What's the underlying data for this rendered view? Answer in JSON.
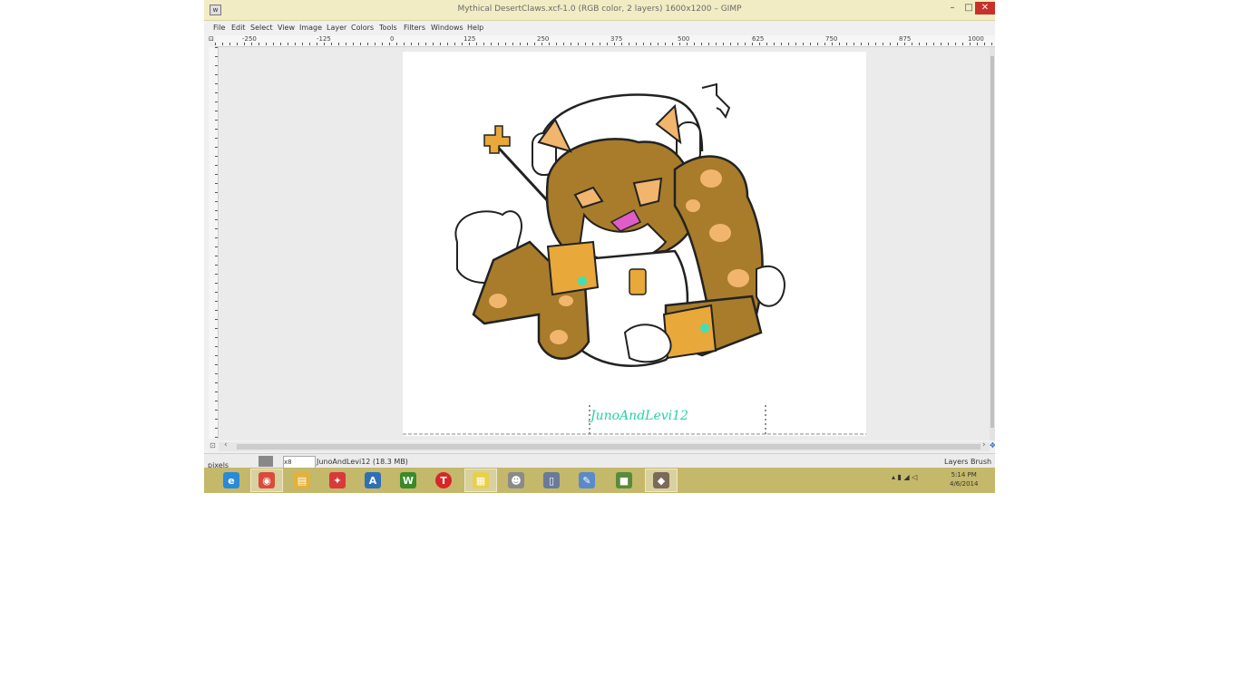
{
  "window": {
    "title": "Mythical DesertClaws.xcf-1.0 (RGB color, 2 layers) 1600x1200 – GIMP",
    "app_icon": "wilber-icon",
    "minimize_label": "–",
    "maximize_label": "□",
    "close_label": "✕"
  },
  "menu": [
    "File",
    "Edit",
    "Select",
    "View",
    "Image",
    "Layer",
    "Colors",
    "Tools",
    "Filters",
    "Windows",
    "Help"
  ],
  "ruler": {
    "corner": "⊡",
    "h_labels": [
      "-250",
      "-125",
      "0",
      "125",
      "250",
      "375",
      "500",
      "625",
      "750",
      "875",
      "1000"
    ]
  },
  "canvas": {
    "signature": "JunoAndLevi12",
    "colors": {
      "fur": "#a87c2a",
      "spots": "#f2b56e",
      "tongue": "#e05cc8",
      "cuff": "#e8a83a",
      "gem": "#3fe0b8",
      "signature": "#22d3a4"
    }
  },
  "statusbar": {
    "unit": "pixels",
    "zoom": "x8",
    "file": "JunoAndLevi12 (18.3 MB)",
    "dock_tabs": "Layers  Brush"
  },
  "taskbar": {
    "apps": [
      {
        "name": "ie-icon",
        "glyph": "e",
        "color": "#2a8ad8"
      },
      {
        "name": "chrome-icon",
        "glyph": "◉",
        "color": "#d94b3b"
      },
      {
        "name": "file-explorer-icon",
        "glyph": "▤",
        "color": "#e3b23c"
      },
      {
        "name": "app-red-icon",
        "glyph": "✦",
        "color": "#d83a3a"
      },
      {
        "name": "app-blue-a-icon",
        "glyph": "A",
        "color": "#2f6fb6"
      },
      {
        "name": "app-w-icon",
        "glyph": "W",
        "color": "#3a8a2a"
      },
      {
        "name": "app-t-icon",
        "glyph": "T",
        "color": "#d62828"
      },
      {
        "name": "sticky-notes-icon",
        "glyph": "▦",
        "color": "#e8d04a"
      },
      {
        "name": "cat-app-icon",
        "glyph": "☻",
        "color": "#8a8a8a"
      },
      {
        "name": "document-icon",
        "glyph": "▯",
        "color": "#6a7a9a"
      },
      {
        "name": "pencil-app-icon",
        "glyph": "✎",
        "color": "#5a8ac8"
      },
      {
        "name": "minecraft-icon",
        "glyph": "■",
        "color": "#5a8a3a"
      },
      {
        "name": "gimp-icon",
        "glyph": "◆",
        "color": "#7a6a5a"
      }
    ],
    "tray": "▴ ▮ ◢ ◁",
    "clock_time": "5:14 PM",
    "clock_date": "4/6/2014"
  }
}
